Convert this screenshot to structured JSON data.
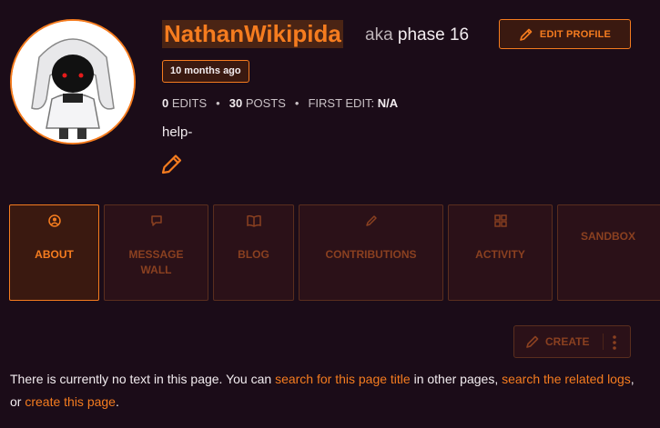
{
  "profile": {
    "username": "NathanWikipida",
    "aka_label": "aka",
    "nickname": "phase 16",
    "tenure": "10 months ago",
    "edit_profile_label": "EDIT PROFILE",
    "stats": {
      "edits_count": "0",
      "edits_label": "EDITS",
      "posts_count": "30",
      "posts_label": "POSTS",
      "first_edit_label": "FIRST EDIT:",
      "first_edit_value": "N/A"
    },
    "bio": "help-"
  },
  "tabs": [
    {
      "label": "ABOUT",
      "icon": "user-circle-icon",
      "active": true
    },
    {
      "label": "MESSAGE WALL",
      "icon": "speech-bubble-icon"
    },
    {
      "label": "BLOG",
      "icon": "book-icon"
    },
    {
      "label": "CONTRIBUTIONS",
      "icon": "pencil-icon"
    },
    {
      "label": "ACTIVITY",
      "icon": "grid-icon"
    },
    {
      "label": "SANDBOX",
      "icon": ""
    }
  ],
  "actions": {
    "create_label": "CREATE"
  },
  "notice": {
    "text1": "There is currently no text in this page. You can ",
    "link1": "search for this page title",
    "text2": " in other pages, ",
    "link2": "search the related logs",
    "text3": ", or ",
    "link3": "create this page",
    "text4": "."
  },
  "colors": {
    "background": "#1b0c18",
    "accent": "#f57c1f",
    "tab_inactive_text": "#8a4020"
  }
}
